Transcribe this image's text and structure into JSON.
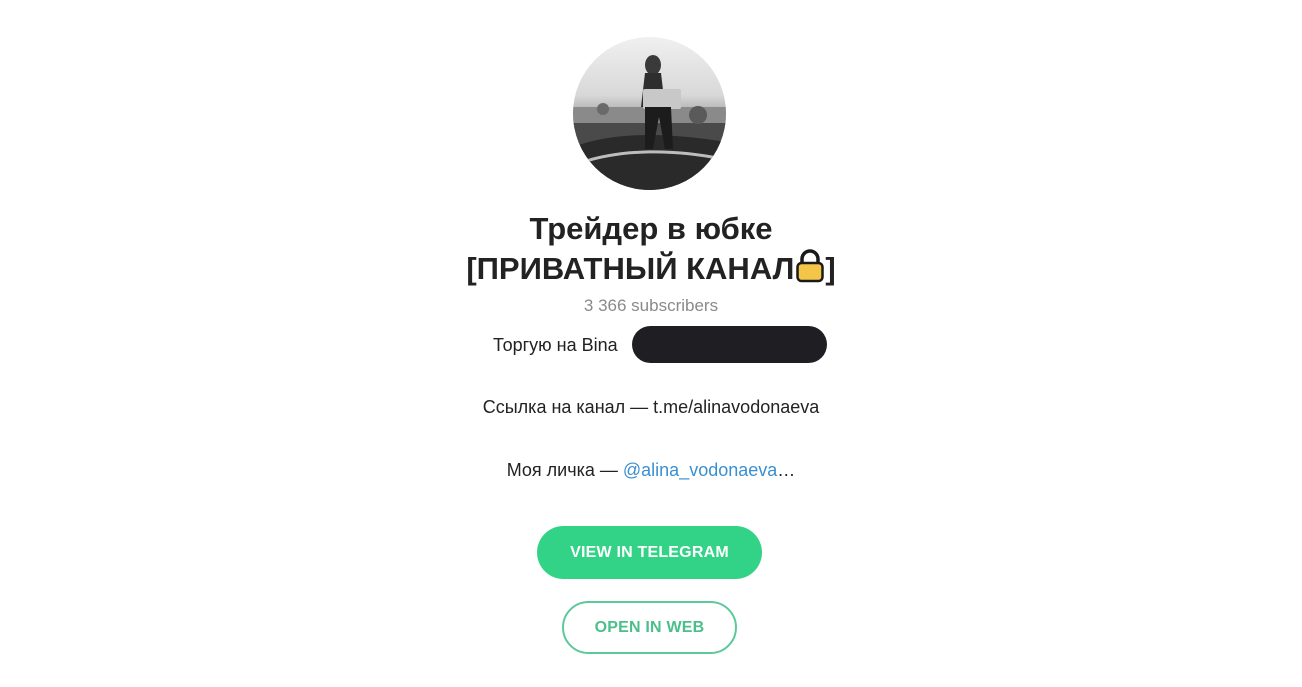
{
  "channel": {
    "title_line1": "Трейдер в юбке",
    "title_line2": "[ПРИВАТНЫЙ КАНАЛ",
    "title_line2_close": "]",
    "title_icon": "lock-icon",
    "subscribers": "3 366 subscribers"
  },
  "description": {
    "line1": "Торгую на Bina",
    "line2": "Ссылка на канал — t.me/alinavodonaeva",
    "line3_prefix": "Моя личка — ",
    "line3_mention": "@alina_vodonaeva",
    "line3_suffix": "…"
  },
  "buttons": {
    "view_in_telegram": "VIEW IN TELEGRAM",
    "open_in_web": "OPEN IN WEB"
  },
  "colors": {
    "primary_green": "#32d386",
    "outline_green": "#5cc99a",
    "link_blue": "#3a8fd1",
    "muted_gray": "#8a8a8a"
  }
}
